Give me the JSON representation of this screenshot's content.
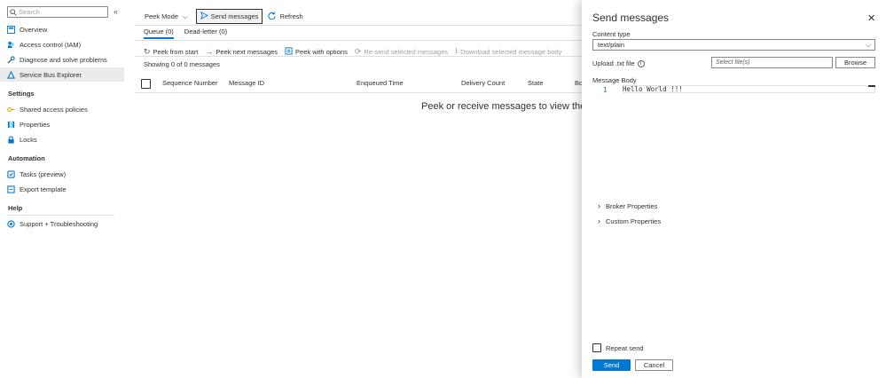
{
  "nav": {
    "search_placeholder": "Search",
    "items": [
      {
        "label": "Overview",
        "icon": "overview-icon"
      },
      {
        "label": "Access control (IAM)",
        "icon": "iam-icon"
      },
      {
        "label": "Diagnose and solve problems",
        "icon": "wrench-icon"
      },
      {
        "label": "Service Bus Explorer",
        "icon": "explorer-icon"
      }
    ],
    "settings_header": "Settings",
    "settings_items": [
      {
        "label": "Shared access policies",
        "icon": "key-icon"
      },
      {
        "label": "Properties",
        "icon": "properties-icon"
      },
      {
        "label": "Locks",
        "icon": "lock-icon"
      }
    ],
    "automation_header": "Automation",
    "automation_items": [
      {
        "label": "Tasks (preview)",
        "icon": "tasks-icon"
      },
      {
        "label": "Export template",
        "icon": "export-icon"
      }
    ],
    "help_header": "Help",
    "help_items": [
      {
        "label": "Support + Troubleshooting",
        "icon": "help-icon"
      }
    ]
  },
  "toolbar": {
    "peek_mode": "Peek Mode",
    "send_messages": "Send messages",
    "refresh": "Refresh"
  },
  "tabs": {
    "queue": "Queue (0)",
    "deadletter": "Dead-letter (0)"
  },
  "commands": {
    "peek_start": "Peek from start",
    "peek_next": "Peek next messages",
    "peek_options": "Peek with options",
    "resend": "Re-send selected messages",
    "download": "Download selected message body"
  },
  "grid": {
    "showing": "Showing 0 of 0 messages",
    "columns": [
      "Sequence Number",
      "Message ID",
      "Enqueued Time",
      "Delivery Count",
      "State",
      "Bo"
    ],
    "empty_message": "Peek or receive messages to view them he"
  },
  "panel": {
    "title": "Send messages",
    "content_type_label": "Content type",
    "content_type_value": "text/plain",
    "upload_label": "Upload .txt file",
    "file_placeholder": "Select file(s)",
    "browse": "Browse",
    "message_body_label": "Message Body",
    "line_number": "1",
    "body_text": "Hello World !!!",
    "broker_properties": "Broker Properties",
    "custom_properties": "Custom Properties",
    "repeat_send": "Repeat send",
    "send": "Send",
    "cancel": "Cancel"
  },
  "colors": {
    "accent": "#0078d4",
    "active_nav_bg": "#edebe9"
  }
}
